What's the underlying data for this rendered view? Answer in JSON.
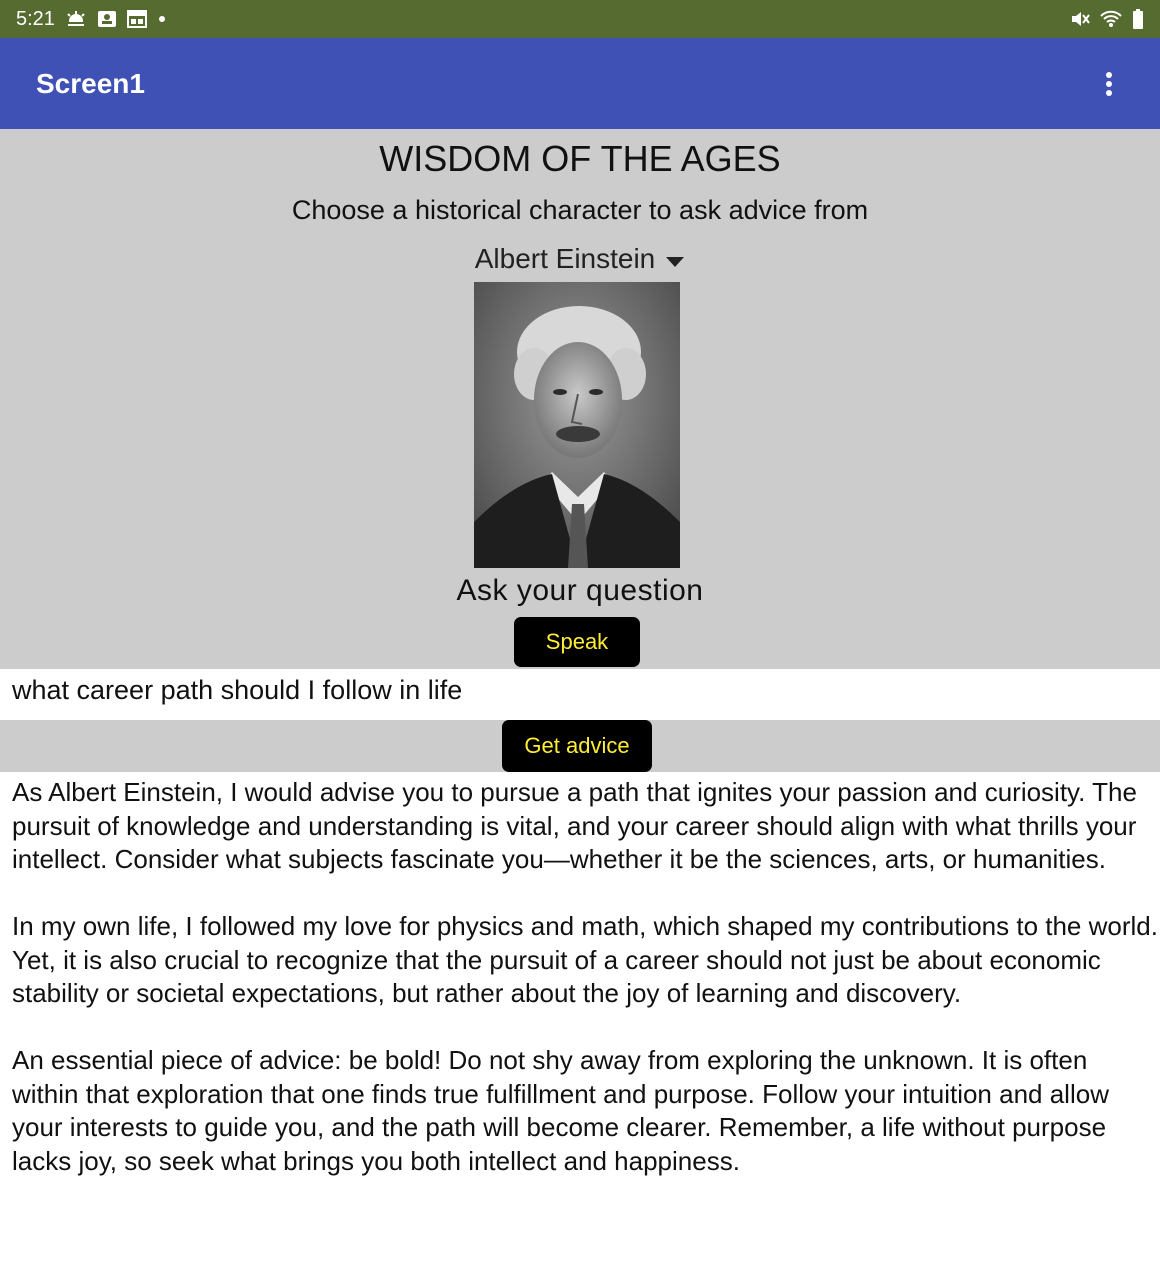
{
  "status_bar": {
    "time": "5:21",
    "left_icons": [
      "weather-icon",
      "contact-card-icon",
      "calendar-icon",
      "dot-icon"
    ],
    "right_icons": [
      "mute-icon",
      "wifi-icon",
      "battery-icon"
    ]
  },
  "app_bar": {
    "title": "Screen1",
    "menu_icon": "more-vert-icon",
    "color": "#3f51b5"
  },
  "main": {
    "heading": "WISDOM OF THE AGES",
    "subheading": "Choose a historical character to ask advice from",
    "character_select": {
      "selected": "Albert Einstein"
    },
    "ask_label": "Ask your question",
    "speak_label": "Speak",
    "question": "what career path should I follow in life",
    "advice_label": "Get advice",
    "answer_paragraphs": [
      "As Albert Einstein, I would advise you to pursue a path that ignites your passion and curiosity. The pursuit of knowledge and understanding is vital, and your career should align with what thrills your intellect. Consider what subjects fascinate you—whether it be the sciences, arts, or humanities.",
      "In my own life, I followed my love for physics and math, which shaped my contributions to the world. Yet, it is also crucial to recognize that the pursuit of a career should not just be about economic stability or societal expectations, but rather about the joy of learning and discovery.",
      "An essential piece of advice: be bold! Do not shy away from exploring the unknown. It is often within that exploration that one finds true fulfillment and purpose. Follow your intuition and allow your interests to guide you, and the path will become clearer. Remember, a life without purpose lacks joy, so seek what brings you both intellect and happiness."
    ]
  },
  "colors": {
    "status_bar": "#556b2f",
    "panel": "#cccccc",
    "button_bg": "#000000",
    "button_text": "#ffee33"
  }
}
